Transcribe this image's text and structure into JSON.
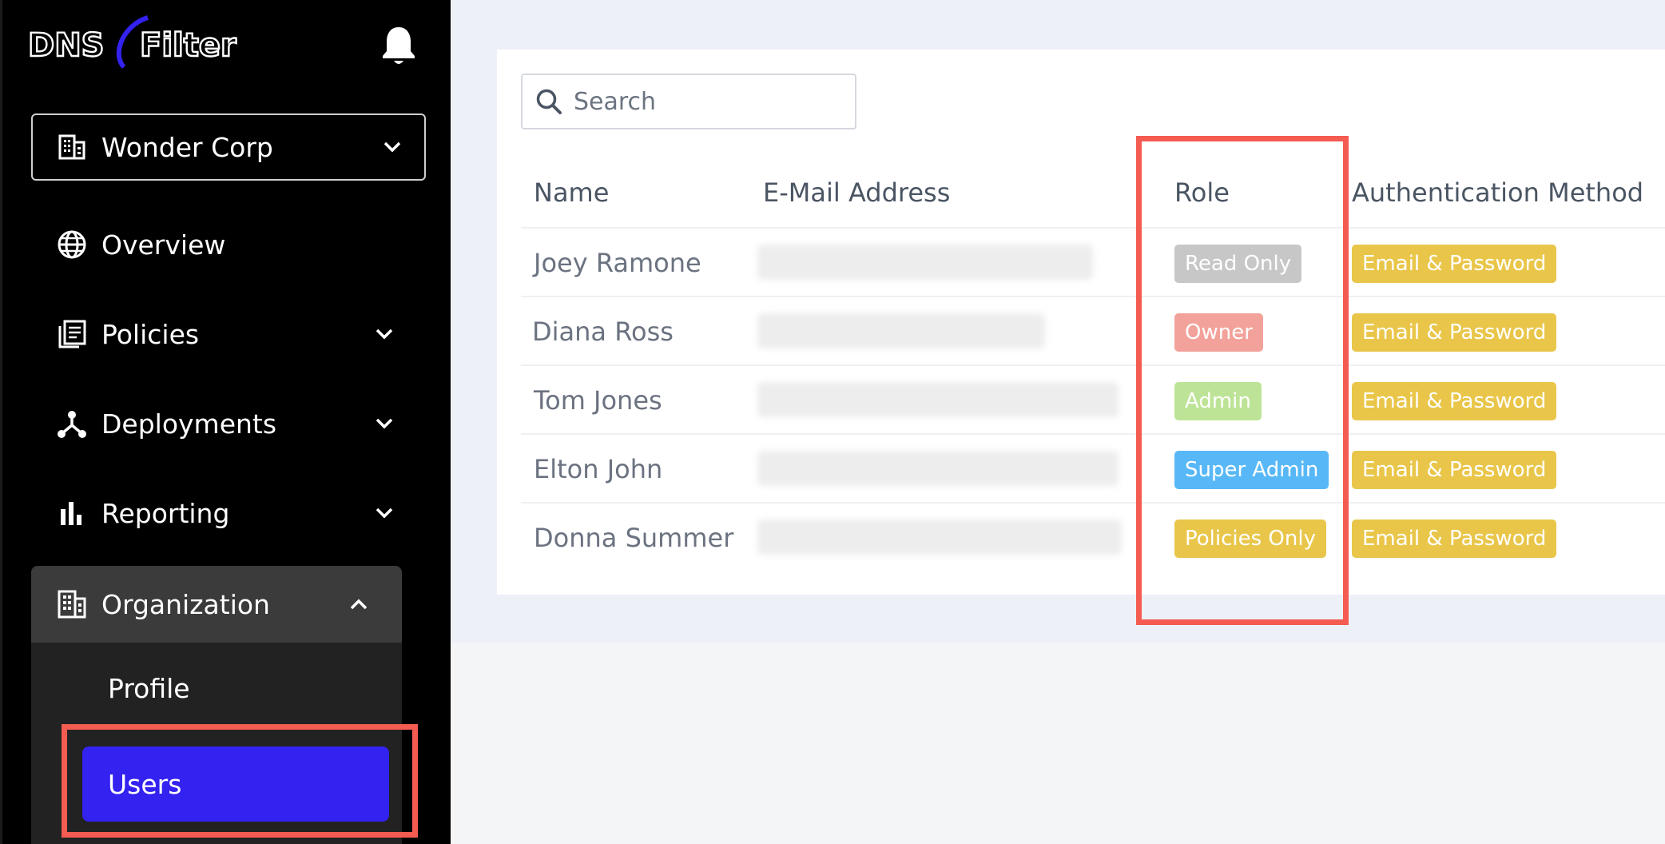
{
  "brand": {
    "logo_text_left": "DNS",
    "logo_text_right": "Filter"
  },
  "sidebar": {
    "org_select": {
      "label": "Wonder Corp"
    },
    "nav": [
      {
        "label": "Overview",
        "icon": "globe-icon",
        "expandable": false
      },
      {
        "label": "Policies",
        "icon": "policies-icon",
        "expandable": true
      },
      {
        "label": "Deployments",
        "icon": "deployments-icon",
        "expandable": true
      },
      {
        "label": "Reporting",
        "icon": "bar-chart-icon",
        "expandable": true
      },
      {
        "label": "Organization",
        "icon": "building-icon",
        "expandable": true,
        "expanded": true
      }
    ],
    "org_sub": {
      "profile": "Profile",
      "users": "Users"
    }
  },
  "search": {
    "placeholder": "Search"
  },
  "table": {
    "headers": {
      "name": "Name",
      "email": "E-Mail Address",
      "role": "Role",
      "auth": "Authentication Method"
    },
    "rows": [
      {
        "name": "Joey Ramone",
        "role": "Read Only",
        "role_color": "#c7c7c7",
        "auth": "Email & Password"
      },
      {
        "name": "Diana Ross",
        "role": "Owner",
        "role_color": "#f2a29a",
        "auth": "Email & Password"
      },
      {
        "name": "Tom Jones",
        "role": "Admin",
        "role_color": "#bde496",
        "auth": "Email & Password"
      },
      {
        "name": "Elton John",
        "role": "Super Admin",
        "role_color": "#58b8f7",
        "auth": "Email & Password"
      },
      {
        "name": "Donna Summer",
        "role": "Policies Only",
        "role_color": "#e9c64a",
        "auth": "Email & Password"
      }
    ],
    "auth_color": "#e9c64a"
  },
  "colors": {
    "sidebar_bg": "#000000",
    "active_nav": "#3322f0",
    "highlight": "#f45b51"
  }
}
